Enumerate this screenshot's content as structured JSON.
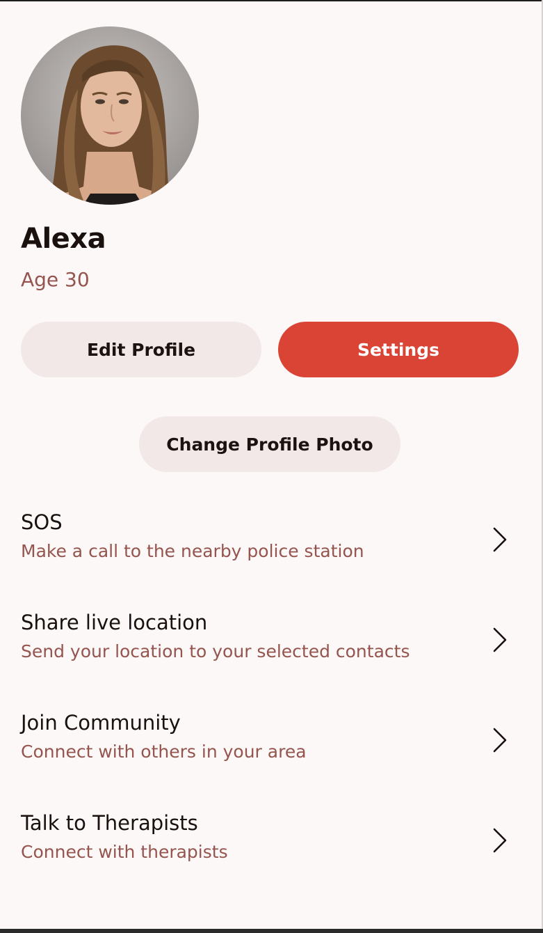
{
  "profile": {
    "name": "Alexa",
    "age_text": "Age 30"
  },
  "actions": {
    "edit_profile": "Edit Profile",
    "settings": "Settings",
    "change_photo": "Change Profile Photo"
  },
  "menu": [
    {
      "title": "SOS",
      "subtitle": "Make a call to the nearby police station",
      "icon": "chevron-right-icon"
    },
    {
      "title": "Share live location",
      "subtitle": "Send your location to your selected contacts",
      "icon": "chevron-right-icon"
    },
    {
      "title": "Join Community",
      "subtitle": "Connect with others in your area",
      "icon": "chevron-right-icon"
    },
    {
      "title": "Talk to Therapists",
      "subtitle": "Connect with therapists",
      "icon": "chevron-right-icon"
    }
  ],
  "colors": {
    "accent": "#d94435",
    "secondary_button": "#f2e8e7",
    "subtitle_text": "#96544e",
    "background": "#fbf8f7"
  }
}
